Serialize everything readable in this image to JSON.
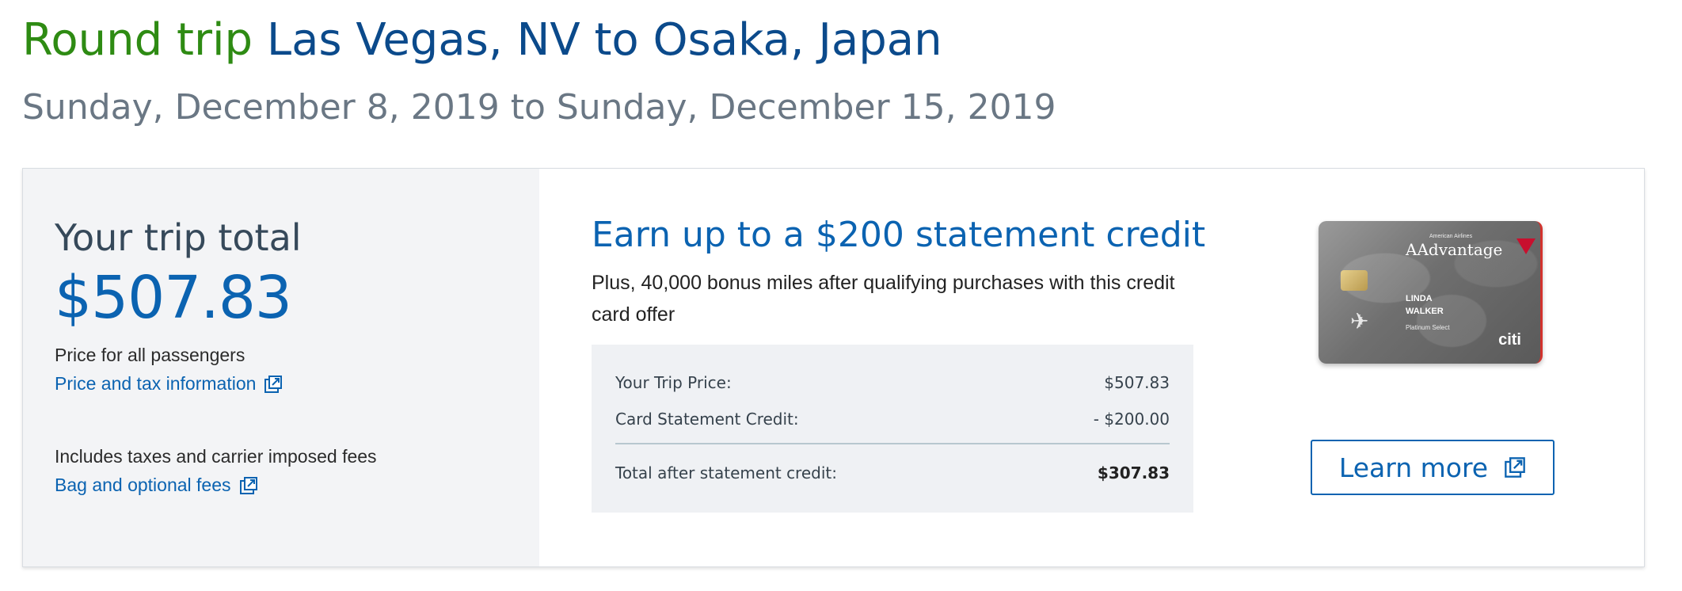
{
  "header": {
    "trip_type": "Round trip",
    "route": "Las Vegas, NV to Osaka, Japan",
    "dates": "Sunday, December 8, 2019 to Sunday, December 15, 2019"
  },
  "summary": {
    "total_label": "Your trip total",
    "total_amount": "$507.83",
    "price_note": "Price for all passengers",
    "price_tax_link": "Price and tax information",
    "fees_note": "Includes taxes and carrier imposed fees",
    "bag_fees_link": "Bag and optional fees"
  },
  "offer": {
    "title": "Earn up to a $200 statement credit",
    "description": "Plus, 40,000 bonus miles after qualifying purchases with this credit card offer",
    "rows": [
      {
        "label": "Your Trip Price:",
        "value": "$507.83"
      },
      {
        "label": "Card Statement Credit:",
        "value": "- $200.00"
      },
      {
        "label": "Total after statement credit:",
        "value": "$307.83"
      }
    ],
    "learn_more": "Learn more"
  },
  "card": {
    "issuer_line": "American Airlines",
    "brand": "AAdvantage",
    "holder_first": "LINDA",
    "holder_last": "WALKER",
    "tier": "Platinum Select",
    "issuer": "citi"
  },
  "colors": {
    "trip_type": "#2e8b13",
    "route": "#0b4a8b",
    "accent": "#0b63b1",
    "subtitle": "#6a7784"
  },
  "icons": {
    "external_link": "external-link-icon"
  }
}
